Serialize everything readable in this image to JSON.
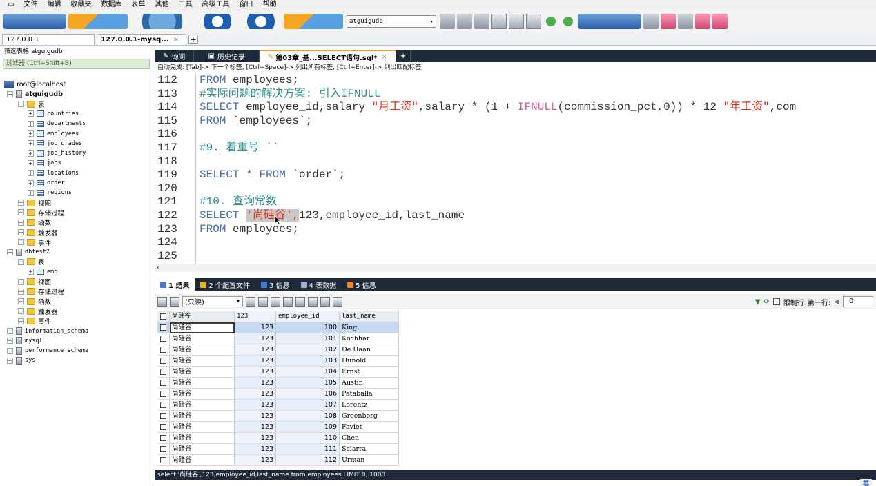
{
  "menu": [
    "文件",
    "编辑",
    "收藏夹",
    "数据库",
    "表单",
    "其他",
    "工具",
    "高级工具",
    "窗口",
    "帮助"
  ],
  "toolbar": {
    "db_selector": "atguigudb"
  },
  "conn_tabs": [
    {
      "label": "127.0.0.1",
      "active": false
    },
    {
      "label": "127.0.0.1-mysq...",
      "active": true
    }
  ],
  "left": {
    "title": "筛选表格 atguigudb",
    "filter_placeholder": "过滤器 (Ctrl+Shift+B)"
  },
  "tree": [
    {
      "label": "root@localhost",
      "depth": 0,
      "icon": "host",
      "pm": ""
    },
    {
      "label": "atguigudb",
      "depth": 1,
      "icon": "db",
      "pm": "−",
      "bold": true
    },
    {
      "label": "表",
      "depth": 2,
      "icon": "folder",
      "pm": "−"
    },
    {
      "label": "countries",
      "depth": 3,
      "icon": "table",
      "pm": "+",
      "mono": true
    },
    {
      "label": "departments",
      "depth": 3,
      "icon": "table",
      "pm": "+",
      "mono": true
    },
    {
      "label": "employees",
      "depth": 3,
      "icon": "table",
      "pm": "+",
      "mono": true
    },
    {
      "label": "job_grades",
      "depth": 3,
      "icon": "table",
      "pm": "+",
      "mono": true
    },
    {
      "label": "job_history",
      "depth": 3,
      "icon": "table",
      "pm": "+",
      "mono": true
    },
    {
      "label": "jobs",
      "depth": 3,
      "icon": "table",
      "pm": "+",
      "mono": true
    },
    {
      "label": "locations",
      "depth": 3,
      "icon": "table",
      "pm": "+",
      "mono": true
    },
    {
      "label": "order",
      "depth": 3,
      "icon": "table",
      "pm": "+",
      "mono": true
    },
    {
      "label": "regions",
      "depth": 3,
      "icon": "table",
      "pm": "+",
      "mono": true
    },
    {
      "label": "视图",
      "depth": 2,
      "icon": "folder",
      "pm": "+"
    },
    {
      "label": "存储过程",
      "depth": 2,
      "icon": "folder",
      "pm": "+"
    },
    {
      "label": "函数",
      "depth": 2,
      "icon": "folder",
      "pm": "+"
    },
    {
      "label": "触发器",
      "depth": 2,
      "icon": "folder",
      "pm": "+"
    },
    {
      "label": "事件",
      "depth": 2,
      "icon": "folder",
      "pm": "+"
    },
    {
      "label": "dbtest2",
      "depth": 1,
      "icon": "db",
      "pm": "−",
      "mono": true
    },
    {
      "label": "表",
      "depth": 2,
      "icon": "folder",
      "pm": "−"
    },
    {
      "label": "emp",
      "depth": 3,
      "icon": "table",
      "pm": "+",
      "mono": true
    },
    {
      "label": "视图",
      "depth": 2,
      "icon": "folder",
      "pm": "+"
    },
    {
      "label": "存储过程",
      "depth": 2,
      "icon": "folder",
      "pm": "+"
    },
    {
      "label": "函数",
      "depth": 2,
      "icon": "folder",
      "pm": "+"
    },
    {
      "label": "触发器",
      "depth": 2,
      "icon": "folder",
      "pm": "+"
    },
    {
      "label": "事件",
      "depth": 2,
      "icon": "folder",
      "pm": "+"
    },
    {
      "label": "information_schema",
      "depth": 1,
      "icon": "db",
      "pm": "+",
      "mono": true
    },
    {
      "label": "mysql",
      "depth": 1,
      "icon": "db",
      "pm": "+",
      "mono": true
    },
    {
      "label": "performance_schema",
      "depth": 1,
      "icon": "db",
      "pm": "+",
      "mono": true
    },
    {
      "label": "sys",
      "depth": 1,
      "icon": "db",
      "pm": "+",
      "mono": true
    }
  ],
  "editor_tabs": [
    {
      "label": "询问",
      "active": false
    },
    {
      "label": "历史记录",
      "active": false
    },
    {
      "label": "第03章_基...SELECT语句.sql*",
      "active": true
    }
  ],
  "hint": "自动完成: [Tab]-> 下一个标签, [Ctrl+Space]-> 列出所有标签, [Ctrl+Enter]-> 列出匹配标签",
  "code_lines": [
    {
      "n": "112",
      "segs": [
        {
          "t": "FROM ",
          "c": "kw"
        },
        {
          "t": "employees;",
          "c": "pl"
        }
      ]
    },
    {
      "n": "113",
      "segs": [
        {
          "t": "#实际问题的解决方案: 引入IFNULL",
          "c": "cm"
        }
      ]
    },
    {
      "n": "114",
      "segs": [
        {
          "t": "SELECT ",
          "c": "kw"
        },
        {
          "t": "employee_id,salary ",
          "c": "pl"
        },
        {
          "t": "\"月工资\"",
          "c": "str"
        },
        {
          "t": ",salary * (1 + ",
          "c": "pl"
        },
        {
          "t": "IFNULL",
          "c": "fn"
        },
        {
          "t": "(commission_pct,0)) * 12 ",
          "c": "pl"
        },
        {
          "t": "\"年工资\"",
          "c": "str"
        },
        {
          "t": ",com",
          "c": "pl"
        }
      ]
    },
    {
      "n": "115",
      "segs": [
        {
          "t": "FROM ",
          "c": "kw"
        },
        {
          "t": "`employees`;",
          "c": "pl"
        }
      ]
    },
    {
      "n": "116",
      "segs": []
    },
    {
      "n": "117",
      "segs": [
        {
          "t": "#9. 着重号 ``",
          "c": "cm"
        }
      ]
    },
    {
      "n": "118",
      "segs": []
    },
    {
      "n": "119",
      "segs": [
        {
          "t": "SELECT ",
          "c": "kw"
        },
        {
          "t": "* ",
          "c": "pl"
        },
        {
          "t": "FROM ",
          "c": "kw"
        },
        {
          "t": "`order`;",
          "c": "pl"
        }
      ]
    },
    {
      "n": "120",
      "segs": []
    },
    {
      "n": "121",
      "segs": [
        {
          "t": "#10. 查询常数",
          "c": "cm"
        }
      ]
    },
    {
      "n": "122",
      "segs": [
        {
          "t": "SELECT ",
          "c": "kw"
        },
        {
          "t": "'尚硅谷',",
          "c": "str",
          "hl": true
        },
        {
          "t": "123,employee_id,last_name",
          "c": "pl"
        }
      ]
    },
    {
      "n": "123",
      "segs": [
        {
          "t": "FROM ",
          "c": "kw"
        },
        {
          "t": "employees;",
          "c": "pl"
        }
      ]
    },
    {
      "n": "124",
      "segs": []
    },
    {
      "n": "125",
      "segs": []
    }
  ],
  "result_tabs": [
    {
      "label": "1 结果",
      "active": true,
      "color": "#3d7bd6"
    },
    {
      "label": "2 个配置文件",
      "active": false,
      "color": "#e6b422"
    },
    {
      "label": "3 信息",
      "active": false,
      "color": "#3d7bd6"
    },
    {
      "label": "4 表数据",
      "active": false,
      "color": "#9fb3cc"
    },
    {
      "label": "5 信息",
      "active": false,
      "color": "#f08a1a"
    }
  ],
  "result_toolbar": {
    "mode": "(只读)",
    "limit_label": "限制行",
    "first_row_label": "第一行:",
    "first_row_value": "0"
  },
  "grid": {
    "headers": [
      "尚硅谷",
      "123",
      "employee_id",
      "last_name"
    ],
    "rows": [
      [
        "尚硅谷",
        "123",
        "100",
        "King"
      ],
      [
        "尚硅谷",
        "123",
        "101",
        "Kochhar"
      ],
      [
        "尚硅谷",
        "123",
        "102",
        "De Haan"
      ],
      [
        "尚硅谷",
        "123",
        "103",
        "Hunold"
      ],
      [
        "尚硅谷",
        "123",
        "104",
        "Ernst"
      ],
      [
        "尚硅谷",
        "123",
        "105",
        "Austin"
      ],
      [
        "尚硅谷",
        "123",
        "106",
        "Pataballa"
      ],
      [
        "尚硅谷",
        "123",
        "107",
        "Lorentz"
      ],
      [
        "尚硅谷",
        "123",
        "108",
        "Greenberg"
      ],
      [
        "尚硅谷",
        "123",
        "109",
        "Faviet"
      ],
      [
        "尚硅谷",
        "123",
        "110",
        "Chen"
      ],
      [
        "尚硅谷",
        "123",
        "111",
        "Sciarra"
      ],
      [
        "尚硅谷",
        "123",
        "112",
        "Urman"
      ]
    ]
  },
  "status": "select '尚硅谷',123,employee_id,last_name from employees LIMIT 0, 1000",
  "ime": "英"
}
